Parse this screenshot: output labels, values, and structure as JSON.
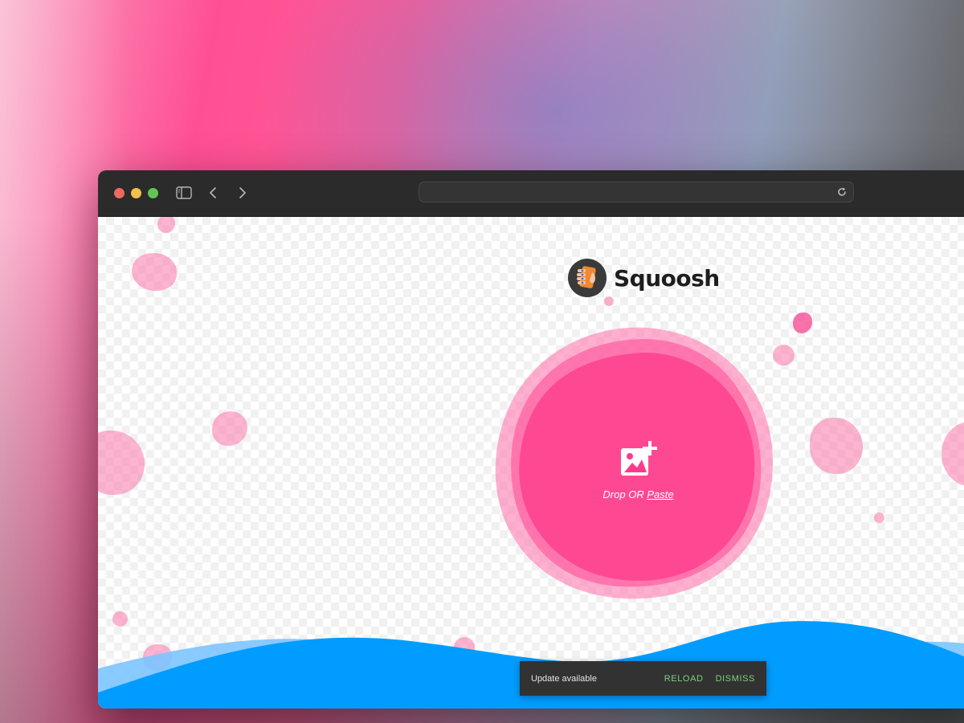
{
  "browser": {
    "address_bar": {
      "value": ""
    }
  },
  "brand": {
    "name": "Squoosh"
  },
  "dropzone": {
    "text_prefix": "Drop OR ",
    "paste_label": "Paste"
  },
  "snackbar": {
    "message": "Update available",
    "reload_label": "RELOAD",
    "dismiss_label": "DISMISS"
  },
  "icons": {
    "sidebar": "sidebar-toggle-icon",
    "back": "chevron-left-icon",
    "forward": "chevron-right-icon",
    "reload": "reload-icon",
    "add_image": "add-image-icon",
    "logo": "squoosh-logo-icon"
  },
  "colors": {
    "accent_pink": "#ff3385",
    "wave_blue": "#009cff",
    "snackbar_bg": "#323232",
    "snackbar_action": "#7fd07a"
  }
}
